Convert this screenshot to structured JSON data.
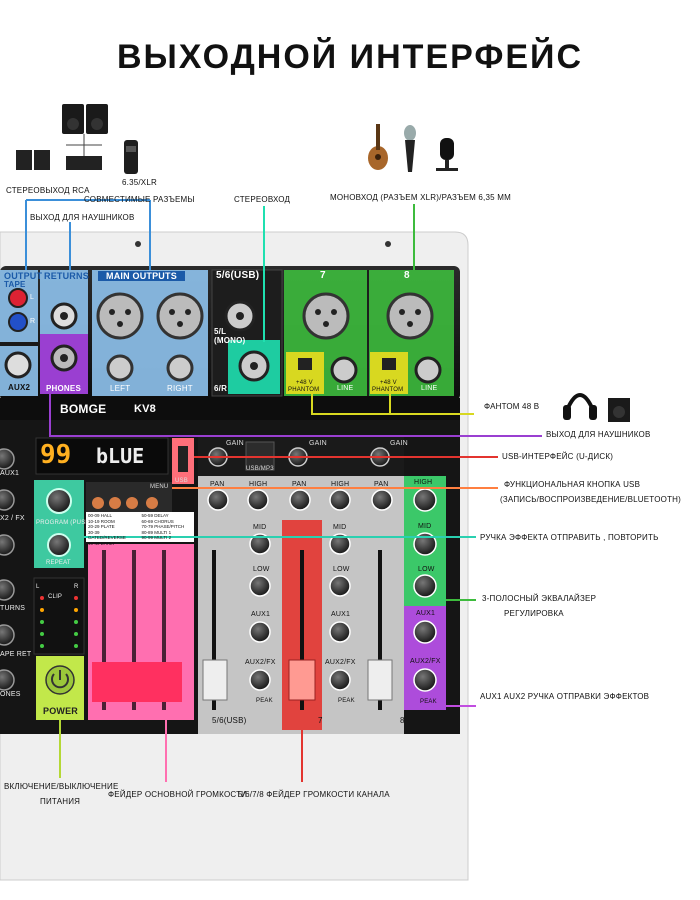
{
  "title": "ВЫХОДНОЙ ИНТЕРФЕЙС",
  "callouts": {
    "rca_out": "СТЕРЕОВЫХОД RCA",
    "jack_xlr": "6.35/XLR",
    "compatible": "СОВМЕСТИМЫЕ РАЗЪЕМЫ",
    "headphone_out_top": "ВЫХОД ДЛЯ НАУШНИКОВ",
    "stereo_in": "СТЕРЕОВХОД",
    "mono_in": "МОНОВХОД (РАЗЪЕМ XLR)/РАЗЪЕМ 6,35 ММ",
    "phantom": "ФАНТОМ 48 В",
    "headphone_out_right": "ВЫХОД ДЛЯ НАУШНИКОВ",
    "usb_interface": "USB-ИНТЕРФЕЙС (U-ДИСК)",
    "usb_button_1": "ФУНКЦИОНАЛЬНАЯ КНОПКА USB",
    "usb_button_2": "(ЗАПИСЬ/ВОСПРОИЗВЕДЕНИЕ/BLUETOOTH)",
    "fx_send": "РУЧКА ЭФФЕКТА ОТПРАВИТЬ , ПОВТОРИТЬ",
    "eq_1": "3-ПОЛОСНЫЙ ЭКВАЛАЙЗЕР",
    "eq_2": "РЕГУЛИРОВКА",
    "aux_send": "AUX1 AUX2 РУЧКА ОТПРАВКИ ЭФФЕКТОВ",
    "power_1": "ВКЛЮЧЕНИЕ/ВЫКЛЮЧЕНИЕ",
    "power_2": "ПИТАНИЯ",
    "main_fader": "ФЕЙДЕР ОСНОВНОЙ ГРОМКОСТИ",
    "channel_fader": "5/6/7/8 ФЕЙДЕР ГРОМКОСТИ КАНАЛА"
  },
  "panel": {
    "output": "OUTPUT",
    "tape": "TAPE",
    "returns": "RETURNS",
    "main_outputs": "MAIN OUTPUTS",
    "ch56_usb": "5/6(USB)",
    "ch7": "7",
    "ch8": "8",
    "l": "L",
    "r": "R",
    "aux2": "AUX2",
    "phones": "PHONES",
    "left": "LEFT",
    "right": "RIGHT",
    "mono_1": "5/L",
    "mono_2": "(MONO)",
    "six_r": "6/R",
    "phantom_v": "+48 V",
    "phantom_label": "PHANTOM",
    "line": "LINE",
    "brand": "BOMGE",
    "model": "KV8",
    "display_num": "99",
    "display_text": "bLUE",
    "menu": "MENU",
    "usb": "USB",
    "usb_mp3": "USB/MP3",
    "gain": "GAIN",
    "pan": "PAN",
    "high": "HIGH",
    "mid": "MID",
    "low": "LOW",
    "aux1": "AUX1",
    "aux2fx": "AUX2/FX",
    "peak": "PEAK",
    "program": "PROGRAM (PUSH)",
    "repeat": "REPEAT",
    "clip": "CLIP",
    "power": "POWER",
    "strip_56": "5/6(USB)",
    "strip_7": "7",
    "strip_8": "8",
    "aux_left": "AUX1",
    "x2fx_left": "X2 / FX",
    "turns_left": "TURNS",
    "apret_left": "APE RET",
    "ones_left": "ONES",
    "fx_presets": [
      "00-09 HALL",
      "10-19 ROOM",
      "20-29 PLATE",
      "30-39 GATED/REVERSE",
      "40-49 EARLY",
      "50-59 DELAY",
      "60-69 CHORUS",
      "70-79 PHASE/PITCH",
      "80-89 MULTI 1",
      "90-99 MULTI 2"
    ]
  },
  "colors": {
    "blue": "#3b8fd9",
    "green": "#3dbb3d",
    "pink": "#ff6fb0",
    "red": "#e3342f",
    "purple": "#9a3fd1",
    "cyan": "#2ad0b0",
    "yellow": "#d8d820"
  }
}
